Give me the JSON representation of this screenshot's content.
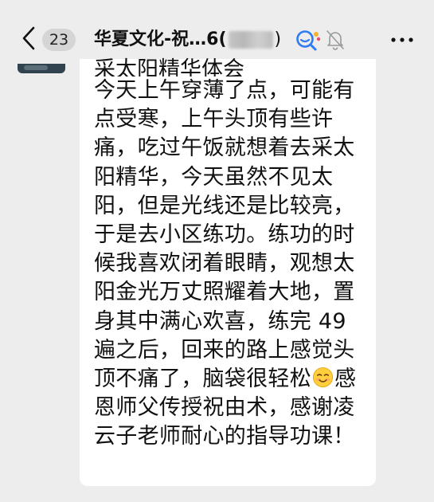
{
  "header": {
    "unread_count": "23",
    "title_prefix": "华夏文化-祝…6(",
    "title_suffix": ")"
  },
  "message": {
    "first_line_partial": "采太阳精华体会",
    "lines": [
      "今天上午穿薄了点，可能有",
      "点受寒，上午头顶有些许",
      "痛，吃过午饭就想着去采太",
      "阳精华，今天虽然不见太",
      "阳，但是光线还是比较亮，",
      "于是去小区练功。练功的时",
      "候我喜欢闭着眼睛，观想太",
      "阳金光万丈照耀着大地，置",
      "身其中满心欢喜，练完 49",
      "遍之后，回来的路上感觉头"
    ],
    "emoji_line_before": "顶不痛了，脑袋很轻松",
    "emoji_line_after": "感",
    "emoji": "smiling-face-emoji",
    "lines_after": [
      "恩师父传授祝由术，感谢凌",
      "云子老师耐心的指导功课！"
    ]
  },
  "colors": {
    "background": "#ededed",
    "bubble": "#ffffff",
    "chat_icon_blue": "#2f7bf5"
  }
}
